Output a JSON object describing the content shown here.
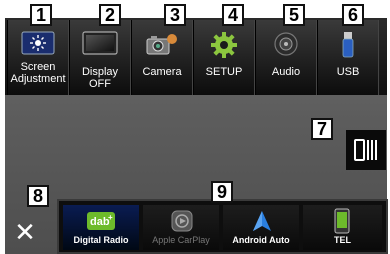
{
  "menu": {
    "items": [
      {
        "label_line1": "Screen",
        "label_line2": "Adjustment",
        "icon": "screen-adjustment-icon",
        "callout": "1"
      },
      {
        "label_line1": "Display OFF",
        "label_line2": "",
        "icon": "display-off-icon",
        "callout": "2"
      },
      {
        "label_line1": "Camera",
        "label_line2": "",
        "icon": "camera-icon",
        "callout": "3"
      },
      {
        "label_line1": "SETUP",
        "label_line2": "",
        "icon": "gear-icon",
        "callout": "4"
      },
      {
        "label_line1": "Audio",
        "label_line2": "",
        "icon": "audio-icon",
        "callout": "5"
      },
      {
        "label_line1": "USB",
        "label_line2": "",
        "icon": "usb-icon",
        "callout": "6"
      }
    ]
  },
  "drawer": {
    "icon": "drawer-icon",
    "callout": "7"
  },
  "close": {
    "glyph": "✕",
    "icon": "close-icon",
    "callout": "8"
  },
  "sources": {
    "callout": "9",
    "items": [
      {
        "label": "Digital Radio",
        "icon": "dab-icon",
        "dim": false
      },
      {
        "label": "Apple CarPlay",
        "icon": "apple-carplay-icon",
        "dim": true
      },
      {
        "label": "Android Auto",
        "icon": "android-auto-icon",
        "dim": false
      },
      {
        "label": "TEL",
        "icon": "phone-icon",
        "dim": false
      }
    ]
  },
  "colors": {
    "screen_bg": "#5d5d5d",
    "menu_bg": "#111111",
    "accent_blue": "#2a7fe0",
    "dab_green": "#6dbb2b"
  }
}
